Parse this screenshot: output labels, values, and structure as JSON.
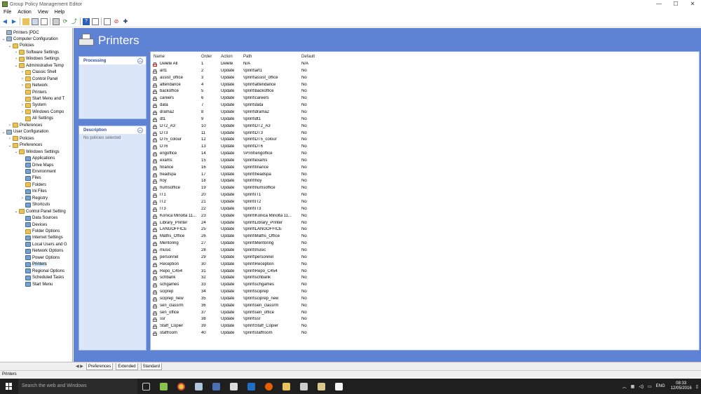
{
  "window": {
    "title": "Group Policy Management Editor",
    "min": "—",
    "max": "☐",
    "close": "✕"
  },
  "menu": [
    "File",
    "Action",
    "View",
    "Help"
  ],
  "tree": [
    {
      "label": "Printers [PDC",
      "level": 0,
      "exp": "",
      "icon": "comp"
    },
    {
      "label": "Computer Configuration",
      "level": 0,
      "exp": "⌄",
      "icon": "comp"
    },
    {
      "label": "Policies",
      "level": 1,
      "exp": "⌄",
      "icon": "folder"
    },
    {
      "label": "Software Settings",
      "level": 2,
      "exp": "›",
      "icon": "folder"
    },
    {
      "label": "Windows Settings",
      "level": 2,
      "exp": "›",
      "icon": "folder"
    },
    {
      "label": "Administrative Temp",
      "level": 2,
      "exp": "⌄",
      "icon": "folder"
    },
    {
      "label": "Classic Shell",
      "level": 3,
      "exp": "›",
      "icon": "folder"
    },
    {
      "label": "Control Panel",
      "level": 3,
      "exp": "›",
      "icon": "folder"
    },
    {
      "label": "Network",
      "level": 3,
      "exp": "›",
      "icon": "folder"
    },
    {
      "label": "Printers",
      "level": 3,
      "exp": "",
      "icon": "folder"
    },
    {
      "label": "Start Menu and T",
      "level": 3,
      "exp": "",
      "icon": "folder"
    },
    {
      "label": "System",
      "level": 3,
      "exp": "›",
      "icon": "folder"
    },
    {
      "label": "Windows Compo",
      "level": 3,
      "exp": "›",
      "icon": "folder"
    },
    {
      "label": "All Settings",
      "level": 3,
      "exp": "",
      "icon": "folder"
    },
    {
      "label": "Preferences",
      "level": 1,
      "exp": "›",
      "icon": "folder"
    },
    {
      "label": "User Configuration",
      "level": 0,
      "exp": "⌄",
      "icon": "comp"
    },
    {
      "label": "Policies",
      "level": 1,
      "exp": "›",
      "icon": "folder"
    },
    {
      "label": "Preferences",
      "level": 1,
      "exp": "⌄",
      "icon": "folder"
    },
    {
      "label": "Windows Settings",
      "level": 2,
      "exp": "⌄",
      "icon": "folder"
    },
    {
      "label": "Applications",
      "level": 3,
      "exp": "",
      "icon": "item"
    },
    {
      "label": "Drive Maps",
      "level": 3,
      "exp": "",
      "icon": "item"
    },
    {
      "label": "Environment",
      "level": 3,
      "exp": "",
      "icon": "item"
    },
    {
      "label": "Files",
      "level": 3,
      "exp": "",
      "icon": "item"
    },
    {
      "label": "Folders",
      "level": 3,
      "exp": "",
      "icon": "folder"
    },
    {
      "label": "Ini Files",
      "level": 3,
      "exp": "",
      "icon": "item"
    },
    {
      "label": "Registry",
      "level": 3,
      "exp": "›",
      "icon": "item"
    },
    {
      "label": "Shortcuts",
      "level": 3,
      "exp": "",
      "icon": "item"
    },
    {
      "label": "Control Panel Setting",
      "level": 2,
      "exp": "⌄",
      "icon": "folder"
    },
    {
      "label": "Data Sources",
      "level": 3,
      "exp": "",
      "icon": "item"
    },
    {
      "label": "Devices",
      "level": 3,
      "exp": "",
      "icon": "item"
    },
    {
      "label": "Folder Options",
      "level": 3,
      "exp": "",
      "icon": "folder"
    },
    {
      "label": "Internet Settings",
      "level": 3,
      "exp": "",
      "icon": "item"
    },
    {
      "label": "Local Users and G",
      "level": 3,
      "exp": "",
      "icon": "item"
    },
    {
      "label": "Network Options",
      "level": 3,
      "exp": "",
      "icon": "item"
    },
    {
      "label": "Power Options",
      "level": 3,
      "exp": "",
      "icon": "item"
    },
    {
      "label": "Printers",
      "level": 3,
      "exp": "",
      "icon": "item",
      "selected": true
    },
    {
      "label": "Regional Options",
      "level": 3,
      "exp": "",
      "icon": "item"
    },
    {
      "label": "Scheduled Tasks",
      "level": 3,
      "exp": "",
      "icon": "item"
    },
    {
      "label": "Start Menu",
      "level": 3,
      "exp": "",
      "icon": "item"
    }
  ],
  "header": {
    "title": "Printers"
  },
  "processing": {
    "title": "Processing"
  },
  "description": {
    "title": "Description",
    "text": "No policies selected"
  },
  "columns": {
    "name": "Name",
    "order": "Order",
    "action": "Action",
    "path": "Path",
    "default": "Default"
  },
  "rows": [
    {
      "name": "Delete All",
      "order": "1",
      "action": "Delete",
      "path": "N/A",
      "default": "N/A",
      "del": true
    },
    {
      "name": "art1",
      "order": "2",
      "action": "Update",
      "path": "\\\\print\\art1",
      "default": "No"
    },
    {
      "name": "assist_office",
      "order": "3",
      "action": "Update",
      "path": "\\\\print\\assist_office",
      "default": "No"
    },
    {
      "name": "attendance",
      "order": "4",
      "action": "Update",
      "path": "\\\\print\\attendance",
      "default": "No"
    },
    {
      "name": "backoffice",
      "order": "5",
      "action": "Update",
      "path": "\\\\print\\backoffice",
      "default": "No"
    },
    {
      "name": "careers",
      "order": "6",
      "action": "Update",
      "path": "\\\\print\\careers",
      "default": "No"
    },
    {
      "name": "data",
      "order": "7",
      "action": "Update",
      "path": "\\\\print\\data",
      "default": "No"
    },
    {
      "name": "drama2",
      "order": "8",
      "action": "Update",
      "path": "\\\\print\\drama2",
      "default": "No"
    },
    {
      "name": "dt1",
      "order": "9",
      "action": "Update",
      "path": "\\\\print\\dt1",
      "default": "No"
    },
    {
      "name": "DT2_A3",
      "order": "10",
      "action": "Update",
      "path": "\\\\print\\DT2_A3",
      "default": "No"
    },
    {
      "name": "DT3",
      "order": "11",
      "action": "Update",
      "path": "\\\\print\\DT3",
      "default": "No"
    },
    {
      "name": "DT5_colour",
      "order": "12",
      "action": "Update",
      "path": "\\\\print\\DT5_colour",
      "default": "No"
    },
    {
      "name": "DT6",
      "order": "13",
      "action": "Update",
      "path": "\\\\print\\DT6",
      "default": "No"
    },
    {
      "name": "engoffice",
      "order": "14",
      "action": "Update",
      "path": "\\\\Print\\engoffice",
      "default": "No"
    },
    {
      "name": "exams",
      "order": "15",
      "action": "Update",
      "path": "\\\\print\\exams",
      "default": "No"
    },
    {
      "name": "finance",
      "order": "16",
      "action": "Update",
      "path": "\\\\print\\finance",
      "default": "No"
    },
    {
      "name": "headspa",
      "order": "17",
      "action": "Update",
      "path": "\\\\print\\headspa",
      "default": "No"
    },
    {
      "name": "hoy",
      "order": "18",
      "action": "Update",
      "path": "\\\\print\\hoy",
      "default": "No"
    },
    {
      "name": "humsoffice",
      "order": "19",
      "action": "Update",
      "path": "\\\\print\\humsoffice",
      "default": "No"
    },
    {
      "name": "IT1",
      "order": "20",
      "action": "Update",
      "path": "\\\\print\\IT1",
      "default": "No"
    },
    {
      "name": "IT2",
      "order": "21",
      "action": "Update",
      "path": "\\\\print\\IT2",
      "default": "No"
    },
    {
      "name": "IT3",
      "order": "22",
      "action": "Update",
      "path": "\\\\print\\IT3",
      "default": "No"
    },
    {
      "name": "Konica Minolta 11...",
      "order": "23",
      "action": "Update",
      "path": "\\\\print\\Konica Minolta 11...",
      "default": "No"
    },
    {
      "name": "Library_Printer",
      "order": "24",
      "action": "Update",
      "path": "\\\\print\\Library_Printer",
      "default": "No"
    },
    {
      "name": "LANGOFFICE",
      "order": "25",
      "action": "Update",
      "path": "\\\\print\\LANGOFFICE",
      "default": "No"
    },
    {
      "name": "Maths_Office",
      "order": "26",
      "action": "Update",
      "path": "\\\\print\\Maths_Office",
      "default": "No"
    },
    {
      "name": "Mentoring",
      "order": "27",
      "action": "Update",
      "path": "\\\\print\\Mentoring",
      "default": "No"
    },
    {
      "name": "music",
      "order": "28",
      "action": "Update",
      "path": "\\\\print\\music",
      "default": "No"
    },
    {
      "name": "personnel",
      "order": "29",
      "action": "Update",
      "path": "\\\\print\\personnel",
      "default": "No"
    },
    {
      "name": "Reception",
      "order": "30",
      "action": "Update",
      "path": "\\\\print\\Reception",
      "default": "No"
    },
    {
      "name": "Repo_C454",
      "order": "31",
      "action": "Update",
      "path": "\\\\print\\Repo_C454",
      "default": "No"
    },
    {
      "name": "schbank",
      "order": "32",
      "action": "Update",
      "path": "\\\\print\\schbank",
      "default": "No"
    },
    {
      "name": "schgames",
      "order": "33",
      "action": "Update",
      "path": "\\\\print\\schgames",
      "default": "No"
    },
    {
      "name": "sciprep",
      "order": "34",
      "action": "Update",
      "path": "\\\\print\\sciprep",
      "default": "No"
    },
    {
      "name": "sciprep_new",
      "order": "35",
      "action": "Update",
      "path": "\\\\print\\sciprep_new",
      "default": "No"
    },
    {
      "name": "sen_classrm",
      "order": "36",
      "action": "Update",
      "path": "\\\\print\\sen_classrm",
      "default": "No"
    },
    {
      "name": "sen_office",
      "order": "37",
      "action": "Update",
      "path": "\\\\print\\sen_office",
      "default": "No"
    },
    {
      "name": "ssr",
      "order": "38",
      "action": "Update",
      "path": "\\\\print\\ssr",
      "default": "No"
    },
    {
      "name": "Staff_Copier",
      "order": "39",
      "action": "Update",
      "path": "\\\\print\\Staff_Copier",
      "default": "No"
    },
    {
      "name": "staffroom",
      "order": "40",
      "action": "Update",
      "path": "\\\\print\\staffroom",
      "default": "No"
    }
  ],
  "tabs": [
    "Preferences",
    "Extended",
    "Standard"
  ],
  "status": "Printers",
  "taskbar": {
    "search": "Search the web and Windows",
    "lang": "ENG",
    "time": "08:33",
    "date": "12/05/2016"
  },
  "colors": {
    "accent": "#5e82d4",
    "panel": "#dbe6f9"
  }
}
